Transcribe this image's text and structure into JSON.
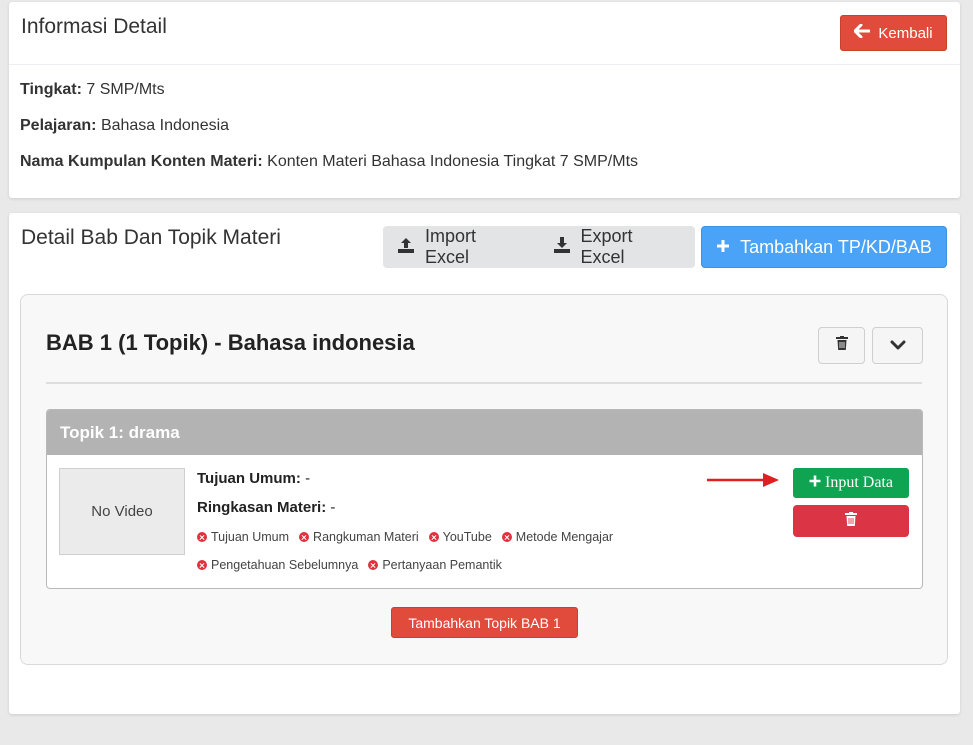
{
  "info_card": {
    "title": "Informasi Detail",
    "back_button": "Kembali",
    "fields": [
      {
        "label": "Tingkat:",
        "value": "7 SMP/Mts"
      },
      {
        "label": "Pelajaran:",
        "value": "Bahasa Indonesia"
      },
      {
        "label": "Nama Kumpulan Konten Materi:",
        "value": "Konten Materi Bahasa Indonesia Tingkat 7 SMP/Mts"
      }
    ]
  },
  "detail_card": {
    "title": "Detail Bab Dan Topik Materi",
    "import_label": "Import Excel",
    "export_label": "Export Excel",
    "add_label": "Tambahkan TP/KD/BAB",
    "bab": {
      "title": "BAB 1 (1 Topik) - Bahasa indonesia",
      "topik": {
        "header": "Topik 1: drama",
        "video_placeholder": "No Video",
        "tujuan_label": "Tujuan Umum:",
        "tujuan_value": "-",
        "ringkasan_label": "Ringkasan Materi:",
        "ringkasan_value": "-",
        "tags_row1": [
          "Tujuan Umum",
          "Rangkuman Materi",
          "YouTube",
          "Metode Mengajar"
        ],
        "tags_row2": [
          "Pengetahuan Sebelumnya",
          "Pertanyaan Pemantik"
        ],
        "input_button": "Input Data"
      },
      "add_topik_button": "Tambahkan Topik BAB 1"
    }
  },
  "colors": {
    "danger": "#e04b3b",
    "primary": "#4aa3f6",
    "success": "#0ea451",
    "delete": "#db3545",
    "tag_missing": "#e0313d"
  },
  "icons": [
    "arrow-left-icon",
    "upload-icon",
    "download-icon",
    "plus-icon",
    "trash-icon",
    "chevron-down-icon",
    "x-circle-icon",
    "red-arrow-icon"
  ]
}
